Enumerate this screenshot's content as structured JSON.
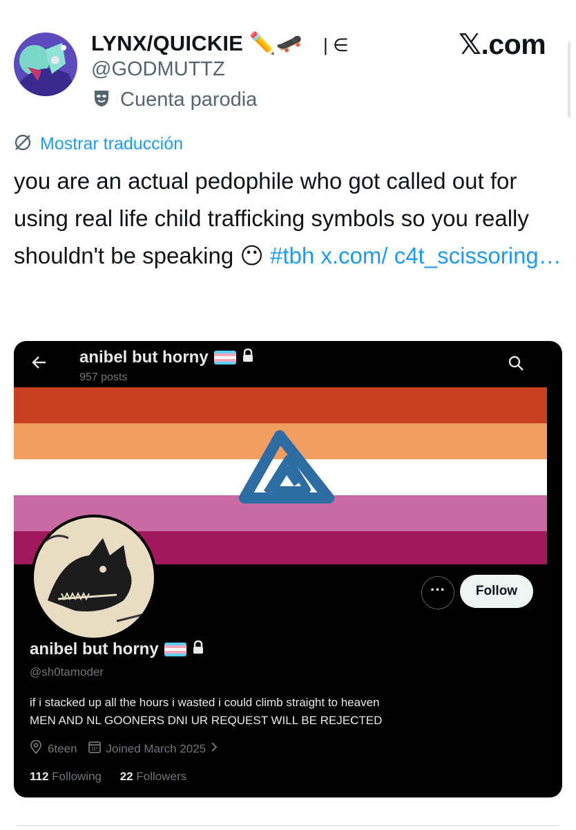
{
  "header": {
    "display_name": "LYNX/QUICKIE ✏️🛹",
    "name_extra": "| ∈",
    "handle": "@GODMUTTZ",
    "parody_label": "Cuenta parodia",
    "brand": "𝕏.com"
  },
  "tweet": {
    "translate_label": "Mostrar traducción",
    "text_part1": "you are an actual pedophile who got called out for using real life child trafficking symbols so you really shouldn't be speaking 😶 ",
    "hashtag": "#tbh",
    "link": " x.com/ c4t_scissoring…"
  },
  "embedded_profile": {
    "top_name": "anibel but horny",
    "posts": "957 posts",
    "more_label": "···",
    "follow_label": "Follow",
    "name": "anibel but horny",
    "handle": "@sh0tamoder",
    "bio_line1": "if i stacked up all the hours i wasted i could climb straight to heaven",
    "bio_line2": "MEN AND NL GOONERS DNI UR REQUEST WILL BE REJECTED",
    "location": "6teen",
    "joined": "Joined March 2025",
    "following_count": "112",
    "following_label": "Following",
    "followers_count": "22",
    "followers_label": "Followers",
    "banner_stripes": [
      "#c7401e",
      "#f29e61",
      "#ffffff",
      "#c86aa3",
      "#a1185b"
    ],
    "symbol_color": "#2e6da4"
  },
  "colors": {
    "link": "#1d9bf0",
    "secondary": "#536471"
  },
  "icons": [
    "avatar",
    "parody-mask-icon",
    "translate-icon",
    "back-arrow-icon",
    "search-icon",
    "trans-flag-icon",
    "lock-icon",
    "location-icon",
    "calendar-icon",
    "chevron-right-icon"
  ]
}
